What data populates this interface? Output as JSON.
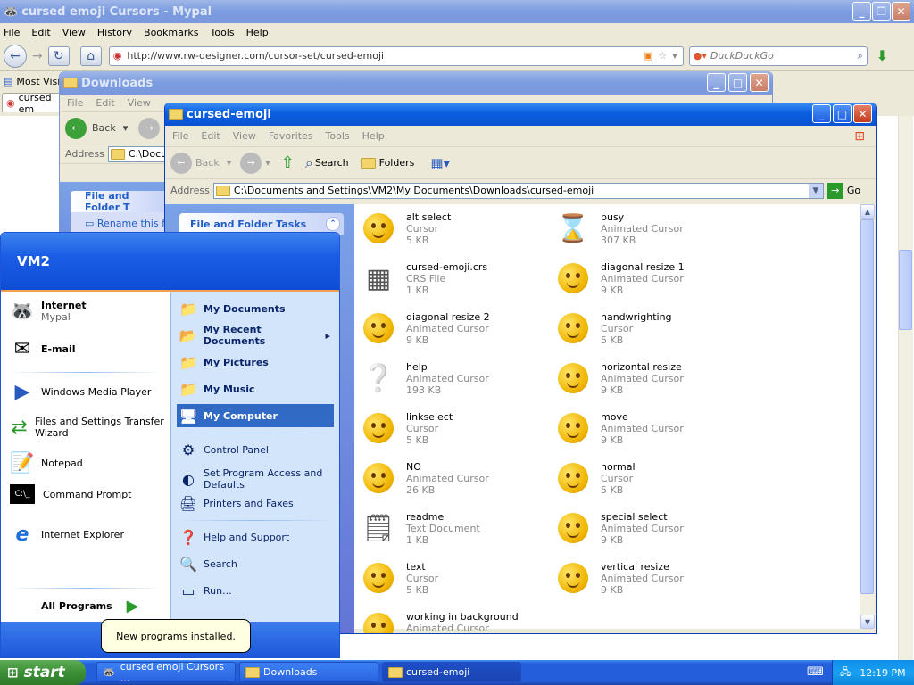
{
  "browser": {
    "title": "cursed emoji Cursors - Mypal",
    "menu": [
      "File",
      "Edit",
      "View",
      "History",
      "Bookmarks",
      "Tools",
      "Help"
    ],
    "url": "http://www.rw-designer.com/cursor-set/cursed-emoji",
    "search_placeholder": "DuckDuckGo",
    "bookmark": "Most Visi",
    "tab": "cursed em"
  },
  "downloads_window": {
    "title": "Downloads",
    "menu": [
      "File",
      "Edit",
      "View"
    ],
    "back": "Back",
    "address_label": "Address",
    "address": "C:\\Docum",
    "task_head": "File and Folder T",
    "task_item": "Rename this f"
  },
  "explorer": {
    "title": "cursed-emoji",
    "menu": [
      "File",
      "Edit",
      "View",
      "Favorites",
      "Tools",
      "Help"
    ],
    "toolbar": {
      "back": "Back",
      "search": "Search",
      "folders": "Folders"
    },
    "address_label": "Address",
    "address": "C:\\Documents and Settings\\VM2\\My Documents\\Downloads\\cursed-emoji",
    "go": "Go",
    "task_head": "File and Folder Tasks",
    "files": [
      {
        "name": "alt select",
        "type": "Cursor",
        "size": "5 KB",
        "icon": "alt-select-icon"
      },
      {
        "name": "busy",
        "type": "Animated Cursor",
        "size": "307 KB",
        "icon": "busy-icon"
      },
      {
        "name": "cursed-emoji.crs",
        "type": "CRS File",
        "size": "1 KB",
        "icon": "crs-file-icon"
      },
      {
        "name": "diagonal resize 1",
        "type": "Animated Cursor",
        "size": "9 KB",
        "icon": "diagonal-resize-icon"
      },
      {
        "name": "diagonal resize 2",
        "type": "Animated Cursor",
        "size": "9 KB",
        "icon": "diagonal-resize-icon"
      },
      {
        "name": "handwrighting",
        "type": "Cursor",
        "size": "5 KB",
        "icon": "handwriting-icon"
      },
      {
        "name": "help",
        "type": "Animated Cursor",
        "size": "193 KB",
        "icon": "help-icon"
      },
      {
        "name": "horizontal resize",
        "type": "Animated Cursor",
        "size": "9 KB",
        "icon": "horizontal-resize-icon"
      },
      {
        "name": "linkselect",
        "type": "Cursor",
        "size": "5 KB",
        "icon": "link-select-icon"
      },
      {
        "name": "move",
        "type": "Animated Cursor",
        "size": "9 KB",
        "icon": "move-icon"
      },
      {
        "name": "NO",
        "type": "Animated Cursor",
        "size": "26 KB",
        "icon": "no-icon"
      },
      {
        "name": "normal",
        "type": "Cursor",
        "size": "5 KB",
        "icon": "normal-icon"
      },
      {
        "name": "readme",
        "type": "Text Document",
        "size": "1 KB",
        "icon": "text-document-icon"
      },
      {
        "name": "special select",
        "type": "Animated Cursor",
        "size": "9 KB",
        "icon": "special-select-icon"
      },
      {
        "name": "text",
        "type": "Cursor",
        "size": "5 KB",
        "icon": "text-cursor-icon"
      },
      {
        "name": "vertical resize",
        "type": "Animated Cursor",
        "size": "9 KB",
        "icon": "vertical-resize-icon"
      },
      {
        "name": "working in background",
        "type": "Animated Cursor",
        "size": "",
        "icon": "working-icon"
      }
    ]
  },
  "start_menu": {
    "user": "VM2",
    "pinned": [
      {
        "label": "Internet",
        "sub": "Mypal"
      },
      {
        "label": "E-mail",
        "sub": ""
      }
    ],
    "recent": [
      "Windows Media Player",
      "Files and Settings Transfer Wizard",
      "Notepad",
      "Command Prompt",
      "Internet Explorer"
    ],
    "all_programs": "All Programs",
    "right_bold": [
      "My Documents",
      "My Recent Documents",
      "My Pictures",
      "My Music",
      "My Computer"
    ],
    "right_normal": [
      "Control Panel",
      "Set Program Access and Defaults",
      "Printers and Faxes"
    ],
    "right_bottom": [
      "Help and Support",
      "Search",
      "Run..."
    ],
    "balloon": "New programs installed."
  },
  "taskbar": {
    "start": "start",
    "tasks": [
      "cursed emoji Cursors ...",
      "Downloads",
      "cursed-emoji"
    ],
    "clock": "12:19 PM"
  },
  "colors": {
    "xp_blue": "#0a5fe0",
    "start_green": "#3c8f35",
    "selection": "#316ac5"
  }
}
